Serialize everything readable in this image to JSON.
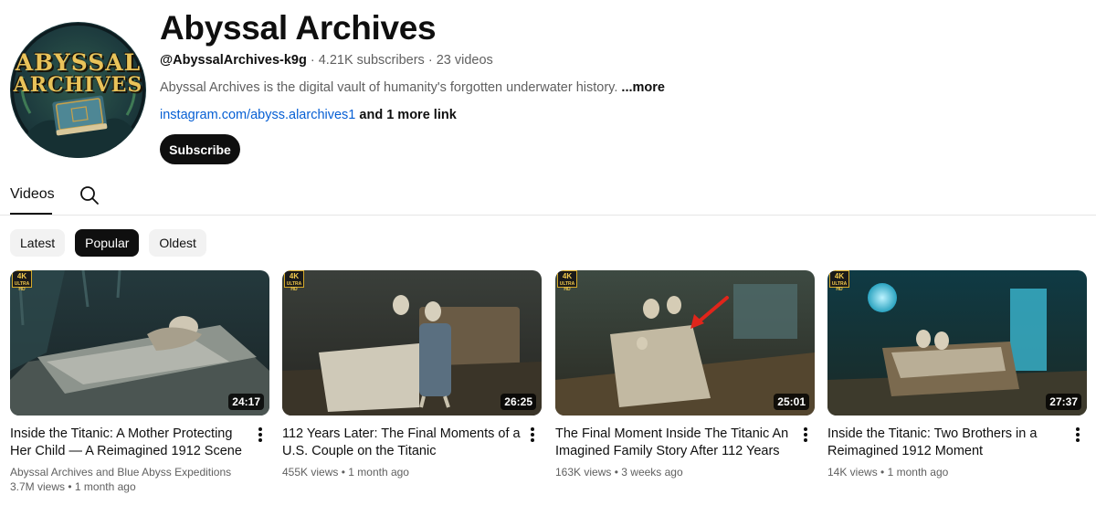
{
  "channel": {
    "logo_line1": "ABYSSAL",
    "logo_line2": "ARCHIVES",
    "name": "Abyssal Archives",
    "handle": "@AbyssalArchives-k9g",
    "subscribers": "4.21K subscribers",
    "video_count": "23 videos",
    "separator": "·",
    "description": "Abyssal Archives is the digital vault of humanity's forgotten underwater history.",
    "more_label": "...more",
    "link": "instagram.com/abyss.alarchives1",
    "more_links": "and 1 more link",
    "subscribe_label": "Subscribe"
  },
  "tabs": {
    "videos_label": "Videos",
    "search_icon": "search-icon"
  },
  "filters": [
    {
      "label": "Latest",
      "active": false
    },
    {
      "label": "Popular",
      "active": true
    },
    {
      "label": "Oldest",
      "active": false
    }
  ],
  "badge": {
    "top": "4K",
    "bottom": "ULTRA HD"
  },
  "videos": [
    {
      "title": "Inside the Titanic: A Mother Protecting Her Child — A Reimagined 1912 Scene",
      "duration": "24:17",
      "author": "Abyssal Archives and Blue Abyss Expeditions",
      "views": "3.7M views",
      "age": "1 month ago"
    },
    {
      "title": "112 Years Later: The Final Moments of a U.S. Couple on the Titanic",
      "duration": "26:25",
      "views": "455K views",
      "age": "1 month ago"
    },
    {
      "title": "The Final Moment Inside The Titanic An Imagined Family Story After 112 Years",
      "duration": "25:01",
      "views": "163K views",
      "age": "3 weeks ago"
    },
    {
      "title": "Inside the Titanic: Two Brothers in a Reimagined 1912 Moment",
      "duration": "27:37",
      "views": "14K views",
      "age": "1 month ago"
    }
  ],
  "colors": {
    "link": "#065fd4",
    "text_secondary": "#606060",
    "chip_active": "#0f0f0f",
    "chip_bg": "#f2f2f2"
  }
}
